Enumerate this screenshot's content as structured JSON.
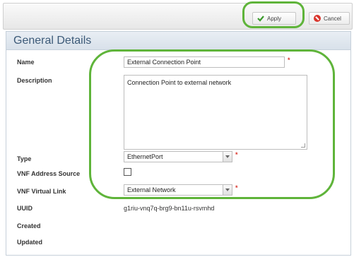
{
  "toolbar": {
    "apply_label": "Apply",
    "cancel_label": "Cancel"
  },
  "panel": {
    "title": "General Details"
  },
  "form": {
    "name_label": "Name",
    "name_value": "External Connection Point",
    "description_label": "Description",
    "description_value": "Connection Point to external network",
    "type_label": "Type",
    "type_value": "EthernetPort",
    "vnf_address_source_label": "VNF Address Source",
    "vnf_address_source_checked": false,
    "vnf_virtual_link_label": "VNF Virtual Link",
    "vnf_virtual_link_value": "External Network",
    "uuid_label": "UUID",
    "uuid_value": "g1riu-vnq7q-brg9-bn11u-rsvmhd",
    "created_label": "Created",
    "updated_label": "Updated",
    "required_marker": "*"
  },
  "colors": {
    "highlight": "#5fb43a",
    "required": "#d9342b",
    "header_text": "#3c5a78"
  },
  "icons": {
    "apply": "check-icon",
    "cancel": "cancel-icon"
  }
}
